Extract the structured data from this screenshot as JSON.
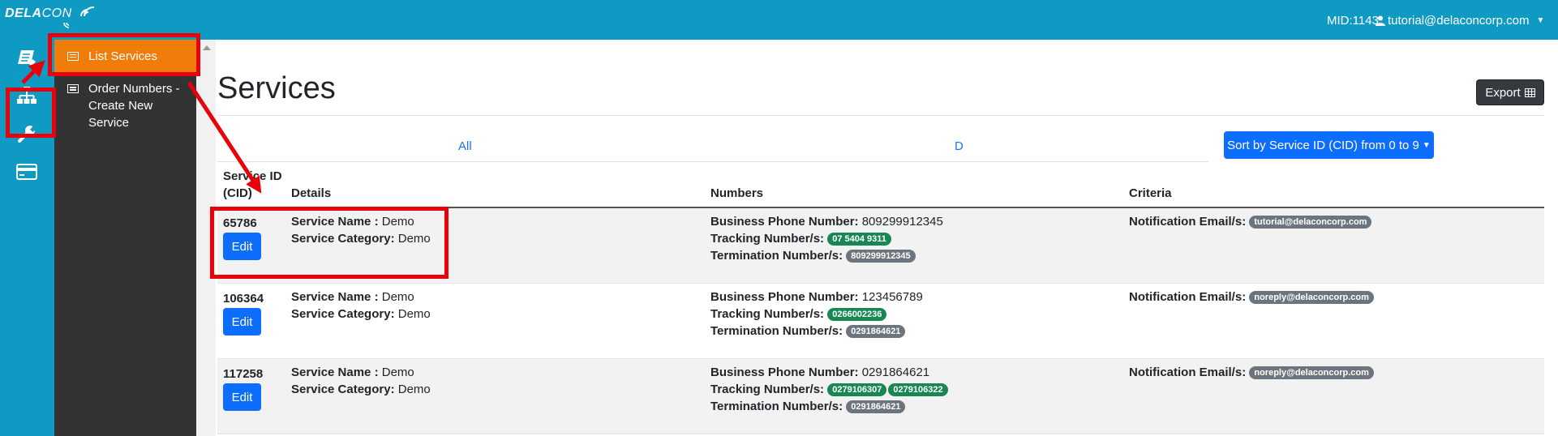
{
  "brand": {
    "name_bold": "DELA",
    "name_light": "CON"
  },
  "header": {
    "mid": "MID:1143",
    "user_email": "tutorial@delaconcorp.com"
  },
  "rail": {
    "icons": [
      "document-icon",
      "sitemap-icon",
      "wrench-icon",
      "credit-card-icon"
    ]
  },
  "sidebar": {
    "items": [
      {
        "label": "List Services",
        "active": true
      },
      {
        "label_lines": [
          "Order Numbers -",
          "Create New",
          "Service"
        ],
        "active": false
      }
    ]
  },
  "page": {
    "title": "Services",
    "export_label": "Export"
  },
  "tabs": [
    {
      "label": "All"
    },
    {
      "label": "D"
    }
  ],
  "sort": {
    "label": "Sort by Service ID (CID) from 0 to 9"
  },
  "table": {
    "headers": {
      "cid_line1": "Service ID",
      "cid_line2": "(CID)",
      "details": "Details",
      "numbers": "Numbers",
      "criteria": "Criteria"
    },
    "labels": {
      "service_name": "Service Name :",
      "service_category": "Service Category:",
      "business_phone": "Business Phone Number:",
      "tracking": "Tracking Number/s:",
      "termination": "Termination Number/s:",
      "notification": "Notification Email/s:",
      "edit": "Edit"
    },
    "rows": [
      {
        "cid": "65786",
        "service_name": "Demo",
        "service_category": "Demo",
        "business_phone": "809299912345",
        "tracking": [
          "07 5404 9311"
        ],
        "termination": [
          "809299912345"
        ],
        "notification": "tutorial@delaconcorp.com"
      },
      {
        "cid": "106364",
        "service_name": "Demo",
        "service_category": "Demo",
        "business_phone": "123456789",
        "tracking": [
          "0266002236"
        ],
        "termination": [
          "0291864621"
        ],
        "notification": "noreply@delaconcorp.com"
      },
      {
        "cid": "117258",
        "service_name": "Demo",
        "service_category": "Demo",
        "business_phone": "0291864621",
        "tracking": [
          "0279106307",
          "0279106322"
        ],
        "termination": [
          "0291864621"
        ],
        "notification": "noreply@delaconcorp.com"
      }
    ]
  },
  "colors": {
    "topbar": "#0f9ac4",
    "sidebar": "#333333",
    "active_item": "#f07c0a",
    "primary": "#0d6efd",
    "annotation": "#e8000b"
  }
}
